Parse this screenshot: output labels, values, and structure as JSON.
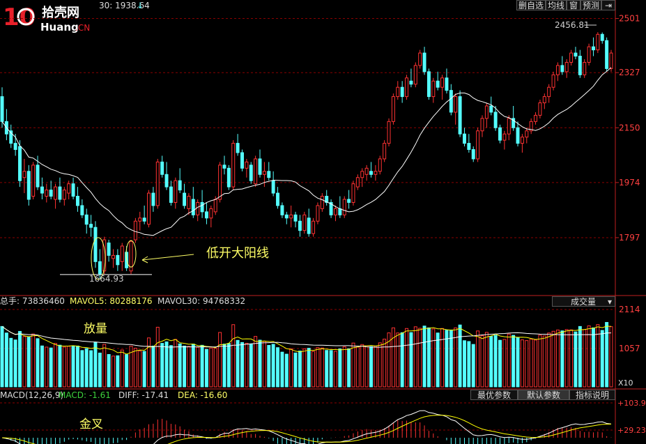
{
  "header": {
    "main_title_text": "30: 1938.64",
    "main_title_arrow": "↓"
  },
  "top_buttons": [
    "删自选",
    "均线",
    "窗",
    "预测",
    "⇥"
  ],
  "logo": {
    "number": "10",
    "chinese": "拾壳网",
    "latin": "Huang",
    "suffix": ".CN"
  },
  "price_axis": {
    "labels": [
      "2501",
      "2327",
      "2150",
      "1974",
      "1797"
    ],
    "values": [
      2501,
      2327,
      2150,
      1974,
      1797
    ]
  },
  "volume_axis": {
    "labels": [
      "2114",
      "1057"
    ],
    "unit_label": "X10"
  },
  "macd_axis": {
    "labels": [
      "+103.9",
      "+29.23"
    ]
  },
  "annotations": {
    "high_label": "2456.81",
    "low_label": "1664.93",
    "big_yang": "低开大阳线",
    "volume_note": "放量",
    "macd_note": "金叉"
  },
  "volume_header": {
    "total": "总手: 73836460",
    "mavol5": "MAVOL5: 80288176",
    "mavol30": "MAVOL30: 94768332",
    "dropdown": "成交量"
  },
  "macd_header": {
    "name": "MACD(12,26,9)",
    "macd": "MACD: -1.61",
    "diff": "DIFF: -17.41",
    "dea": "DEA: -16.60"
  },
  "macd_buttons": [
    "最优参数",
    "默认参数",
    "指标说明"
  ],
  "colors": {
    "up": "#ff3232",
    "down": "#54ffff",
    "ma": "#ffffff",
    "ma5": "#ffff00",
    "grid": "#8b0000"
  },
  "chart_data": {
    "type": "candlestick",
    "price_range": [
      1620,
      2520
    ],
    "candles": [
      [
        2250,
        2280,
        2150,
        2170
      ],
      [
        2170,
        2210,
        2110,
        2130
      ],
      [
        2140,
        2160,
        2085,
        2100
      ],
      [
        2100,
        2130,
        2060,
        2080
      ],
      [
        2090,
        2110,
        1960,
        1980
      ],
      [
        1990,
        2050,
        1940,
        2010
      ],
      [
        2010,
        2030,
        1900,
        1920
      ],
      [
        1930,
        2040,
        1920,
        2030
      ],
      [
        2030,
        2060,
        1950,
        1960
      ],
      [
        1960,
        1990,
        1920,
        1940
      ],
      [
        1930,
        1970,
        1910,
        1950
      ],
      [
        1950,
        1980,
        1920,
        1930
      ],
      [
        1920,
        1970,
        1890,
        1960
      ],
      [
        1960,
        1990,
        1910,
        1920
      ],
      [
        1920,
        1960,
        1900,
        1950
      ],
      [
        1940,
        1980,
        1920,
        1970
      ],
      [
        1970,
        1990,
        1920,
        1930
      ],
      [
        1930,
        1960,
        1880,
        1900
      ],
      [
        1900,
        1920,
        1860,
        1870
      ],
      [
        1870,
        1890,
        1810,
        1840
      ],
      [
        1840,
        1870,
        1800,
        1830
      ],
      [
        1830,
        1850,
        1700,
        1720
      ],
      [
        1720,
        1760,
        1665,
        1680
      ],
      [
        1690,
        1800,
        1680,
        1790
      ],
      [
        1780,
        1790,
        1720,
        1740
      ],
      [
        1730,
        1760,
        1700,
        1740
      ],
      [
        1740,
        1760,
        1690,
        1710
      ],
      [
        1720,
        1780,
        1690,
        1770
      ],
      [
        1750,
        1770,
        1690,
        1700
      ],
      [
        1690,
        1790,
        1680,
        1785
      ],
      [
        1790,
        1860,
        1780,
        1850
      ],
      [
        1850,
        1880,
        1820,
        1860
      ],
      [
        1860,
        1900,
        1840,
        1850
      ],
      [
        1840,
        1950,
        1830,
        1940
      ],
      [
        1940,
        1960,
        1880,
        1900
      ],
      [
        1900,
        2050,
        1890,
        2040
      ],
      [
        2040,
        2060,
        1990,
        2000
      ],
      [
        2000,
        2040,
        1950,
        1960
      ],
      [
        1960,
        1980,
        1900,
        1910
      ],
      [
        1910,
        1990,
        1890,
        1980
      ],
      [
        1980,
        2020,
        1940,
        1950
      ],
      [
        1940,
        1970,
        1890,
        1900
      ],
      [
        1890,
        1940,
        1870,
        1930
      ],
      [
        1920,
        1960,
        1860,
        1870
      ],
      [
        1870,
        1920,
        1850,
        1910
      ],
      [
        1910,
        1950,
        1860,
        1880
      ],
      [
        1880,
        1910,
        1840,
        1860
      ],
      [
        1860,
        1900,
        1830,
        1890
      ],
      [
        1880,
        1930,
        1870,
        1920
      ],
      [
        1920,
        2040,
        1910,
        2030
      ],
      [
        2030,
        2060,
        2000,
        2020
      ],
      [
        2020,
        2030,
        1950,
        1960
      ],
      [
        1960,
        2110,
        1950,
        2100
      ],
      [
        2100,
        2130,
        2060,
        2070
      ],
      [
        2070,
        2080,
        2010,
        2020
      ],
      [
        2020,
        2050,
        1990,
        2040
      ],
      [
        2030,
        2040,
        1970,
        1980
      ],
      [
        1970,
        2060,
        1960,
        2050
      ],
      [
        2050,
        2080,
        1990,
        2000
      ],
      [
        2000,
        2040,
        1960,
        2010
      ],
      [
        2010,
        2040,
        1980,
        1990
      ],
      [
        1980,
        2010,
        1930,
        1940
      ],
      [
        1940,
        1960,
        1890,
        1900
      ],
      [
        1900,
        1910,
        1860,
        1870
      ],
      [
        1870,
        1880,
        1840,
        1860
      ],
      [
        1860,
        1900,
        1830,
        1870
      ],
      [
        1870,
        1880,
        1830,
        1850
      ],
      [
        1850,
        1870,
        1800,
        1820
      ],
      [
        1820,
        1880,
        1810,
        1870
      ],
      [
        1860,
        1890,
        1800,
        1810
      ],
      [
        1810,
        1860,
        1800,
        1850
      ],
      [
        1850,
        1910,
        1840,
        1900
      ],
      [
        1890,
        1940,
        1880,
        1930
      ],
      [
        1930,
        1950,
        1900,
        1910
      ],
      [
        1910,
        1920,
        1860,
        1870
      ],
      [
        1870,
        1900,
        1850,
        1890
      ],
      [
        1890,
        1930,
        1860,
        1870
      ],
      [
        1870,
        1930,
        1860,
        1920
      ],
      [
        1920,
        1950,
        1890,
        1910
      ],
      [
        1910,
        1980,
        1900,
        1970
      ],
      [
        1960,
        2000,
        1950,
        1990
      ],
      [
        1990,
        2020,
        1960,
        2010
      ],
      [
        2000,
        2030,
        1980,
        2020
      ],
      [
        2010,
        2040,
        1990,
        2000
      ],
      [
        2000,
        2030,
        1980,
        2010
      ],
      [
        2010,
        2060,
        2000,
        2050
      ],
      [
        2050,
        2110,
        2040,
        2100
      ],
      [
        2100,
        2180,
        2090,
        2170
      ],
      [
        2170,
        2260,
        2160,
        2250
      ],
      [
        2250,
        2300,
        2240,
        2280
      ],
      [
        2280,
        2300,
        2230,
        2250
      ],
      [
        2250,
        2320,
        2240,
        2310
      ],
      [
        2300,
        2340,
        2280,
        2290
      ],
      [
        2290,
        2360,
        2280,
        2350
      ],
      [
        2350,
        2400,
        2340,
        2390
      ],
      [
        2390,
        2410,
        2320,
        2330
      ],
      [
        2330,
        2340,
        2240,
        2250
      ],
      [
        2250,
        2310,
        2230,
        2300
      ],
      [
        2300,
        2330,
        2270,
        2280
      ],
      [
        2280,
        2320,
        2240,
        2310
      ],
      [
        2310,
        2340,
        2260,
        2270
      ],
      [
        2270,
        2290,
        2190,
        2200
      ],
      [
        2200,
        2260,
        2160,
        2250
      ],
      [
        2250,
        2270,
        2120,
        2130
      ],
      [
        2130,
        2150,
        2090,
        2100
      ],
      [
        2100,
        2130,
        2070,
        2080
      ],
      [
        2080,
        2090,
        2040,
        2050
      ],
      [
        2050,
        2150,
        2040,
        2140
      ],
      [
        2140,
        2190,
        2120,
        2180
      ],
      [
        2180,
        2230,
        2150,
        2220
      ],
      [
        2220,
        2250,
        2190,
        2200
      ],
      [
        2200,
        2220,
        2140,
        2150
      ],
      [
        2150,
        2160,
        2100,
        2110
      ],
      [
        2110,
        2140,
        2080,
        2130
      ],
      [
        2130,
        2190,
        2110,
        2180
      ],
      [
        2180,
        2220,
        2140,
        2150
      ],
      [
        2150,
        2170,
        2090,
        2100
      ],
      [
        2100,
        2130,
        2070,
        2120
      ],
      [
        2120,
        2150,
        2100,
        2140
      ],
      [
        2140,
        2180,
        2130,
        2170
      ],
      [
        2170,
        2200,
        2160,
        2190
      ],
      [
        2190,
        2240,
        2180,
        2230
      ],
      [
        2230,
        2260,
        2210,
        2250
      ],
      [
        2250,
        2290,
        2230,
        2280
      ],
      [
        2280,
        2330,
        2270,
        2320
      ],
      [
        2320,
        2360,
        2300,
        2350
      ],
      [
        2350,
        2380,
        2320,
        2330
      ],
      [
        2330,
        2370,
        2310,
        2360
      ],
      [
        2360,
        2400,
        2350,
        2390
      ],
      [
        2390,
        2410,
        2370,
        2380
      ],
      [
        2380,
        2400,
        2310,
        2320
      ],
      [
        2320,
        2370,
        2310,
        2360
      ],
      [
        2360,
        2420,
        2350,
        2410
      ],
      [
        2410,
        2440,
        2380,
        2400
      ],
      [
        2400,
        2457,
        2390,
        2450
      ],
      [
        2450,
        2456,
        2420,
        2430
      ],
      [
        2430,
        2440,
        2330,
        2340
      ],
      [
        2340,
        2400,
        2330,
        2390
      ]
    ]
  }
}
